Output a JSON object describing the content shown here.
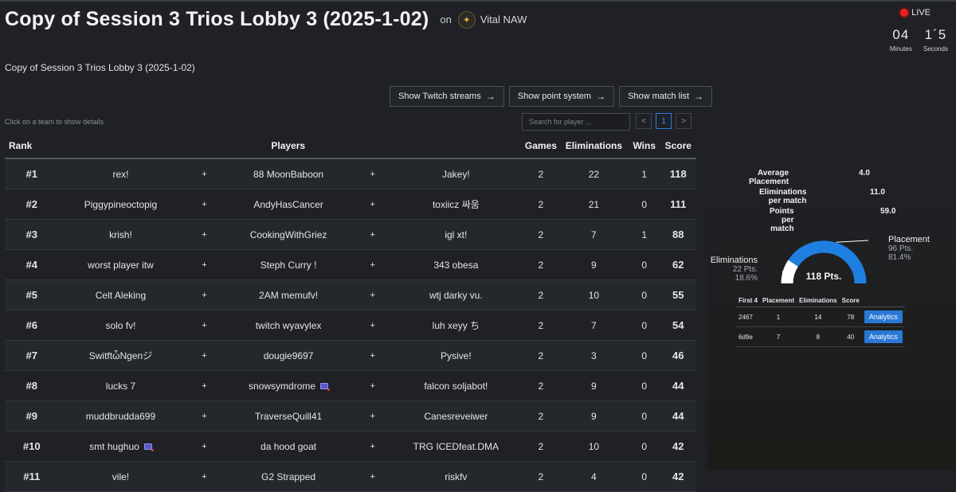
{
  "header": {
    "title": "Copy of Session 3 Trios Lobby 3 (2025-1-02)",
    "on_text": "on",
    "org_name": "Vital NAW"
  },
  "live": {
    "label": "LIVE",
    "minutes_value": "04",
    "minutes_label": "Minutes",
    "seconds_value": "1´5",
    "seconds_label": "Seconds"
  },
  "subtitle": "Copy of Session 3 Trios Lobby 3 (2025-1-02)",
  "buttons": {
    "twitch": "Show Twitch streams",
    "points": "Show point system",
    "matches": "Show match list"
  },
  "hint": "Click on a team to show details",
  "search": {
    "placeholder": "Search for player ..."
  },
  "pagination": {
    "prev": "<",
    "current": "1",
    "next": ">"
  },
  "columns": {
    "rank": "Rank",
    "players": "Players",
    "games": "Games",
    "elims": "Eliminations",
    "wins": "Wins",
    "score": "Score"
  },
  "plus": "+",
  "teams": [
    {
      "rank": "#1",
      "p1": "rex!",
      "p2": "88 MoonBaboon",
      "p3": "Jakey!",
      "games": "2",
      "elims": "22",
      "wins": "1",
      "score": "118"
    },
    {
      "rank": "#2",
      "p1": "Piggypineoctopig",
      "p2": "AndyHasCancer",
      "p3": "toxiicz 싸움",
      "games": "2",
      "elims": "21",
      "wins": "0",
      "score": "111"
    },
    {
      "rank": "#3",
      "p1": "krish!",
      "p2": "CookingWithGriez",
      "p3": "igl xt!",
      "games": "2",
      "elims": "7",
      "wins": "1",
      "score": "88"
    },
    {
      "rank": "#4",
      "p1": "worst player itw",
      "p2": "Steph Curry !",
      "p3": "343 obesa",
      "games": "2",
      "elims": "9",
      "wins": "0",
      "score": "62"
    },
    {
      "rank": "#5",
      "p1": "Celt Aleking",
      "p2": "2AM memufv!",
      "p3": "wtj darky vu.",
      "games": "2",
      "elims": "10",
      "wins": "0",
      "score": "55"
    },
    {
      "rank": "#6",
      "p1": "solo fv!",
      "p2": "twitch wyavylex",
      "p3": "luh xeyy ち",
      "games": "2",
      "elims": "7",
      "wins": "0",
      "score": "54"
    },
    {
      "rank": "#7",
      "p1": "SwitftὧNgenジ",
      "p2": "dougie9697",
      "p3": "Pysive!",
      "games": "2",
      "elims": "3",
      "wins": "0",
      "score": "46"
    },
    {
      "rank": "#8",
      "p1": "lucks 7",
      "p2": "snowsymdrome",
      "p3": "falcon soljabot!",
      "games": "2",
      "elims": "9",
      "wins": "0",
      "score": "44"
    },
    {
      "rank": "#9",
      "p1": "muddbrudda699",
      "p2": "TraverseQuill41",
      "p3": "Canesreveiwer",
      "games": "2",
      "elims": "9",
      "wins": "0",
      "score": "44"
    },
    {
      "rank": "#10",
      "p1": "smt hughuo",
      "p2": "da hood goat",
      "p3": "TRG ICEDfeat.DMA",
      "games": "2",
      "elims": "10",
      "wins": "0",
      "score": "42"
    },
    {
      "rank": "#11",
      "p1": "vile!",
      "p2": "G2 Strapped",
      "p3": "riskfv",
      "games": "2",
      "elims": "4",
      "wins": "0",
      "score": "42"
    }
  ],
  "details": {
    "stats": {
      "avg_placement_label": "Average Placement",
      "avg_placement": "4.0",
      "elims_per_match_label": "Eliminations per match",
      "elims_per_match": "11.0",
      "points_per_match_label": "Points per match",
      "points_per_match": "59.0"
    },
    "gauge": {
      "total": "118 Pts.",
      "elims_label": "Eliminations",
      "elims_pts": "22 Pts.",
      "elims_pct": "18.6%",
      "placement_label": "Placement",
      "placement_pts": "96 Pts.",
      "placement_pct": "81.4%",
      "placement_fraction": 0.814,
      "placement_color": "#1e7fe0",
      "elims_color": "#ffffff"
    },
    "match_columns": {
      "id": "First 4",
      "placement": "Placement",
      "elims": "Eliminations",
      "score": "Score"
    },
    "matches": [
      {
        "id": "2467",
        "placement": "1",
        "elims": "14",
        "score": "78",
        "action": "Analytics"
      },
      {
        "id": "6d9e",
        "placement": "7",
        "elims": "8",
        "score": "40",
        "action": "Analytics"
      }
    ]
  }
}
